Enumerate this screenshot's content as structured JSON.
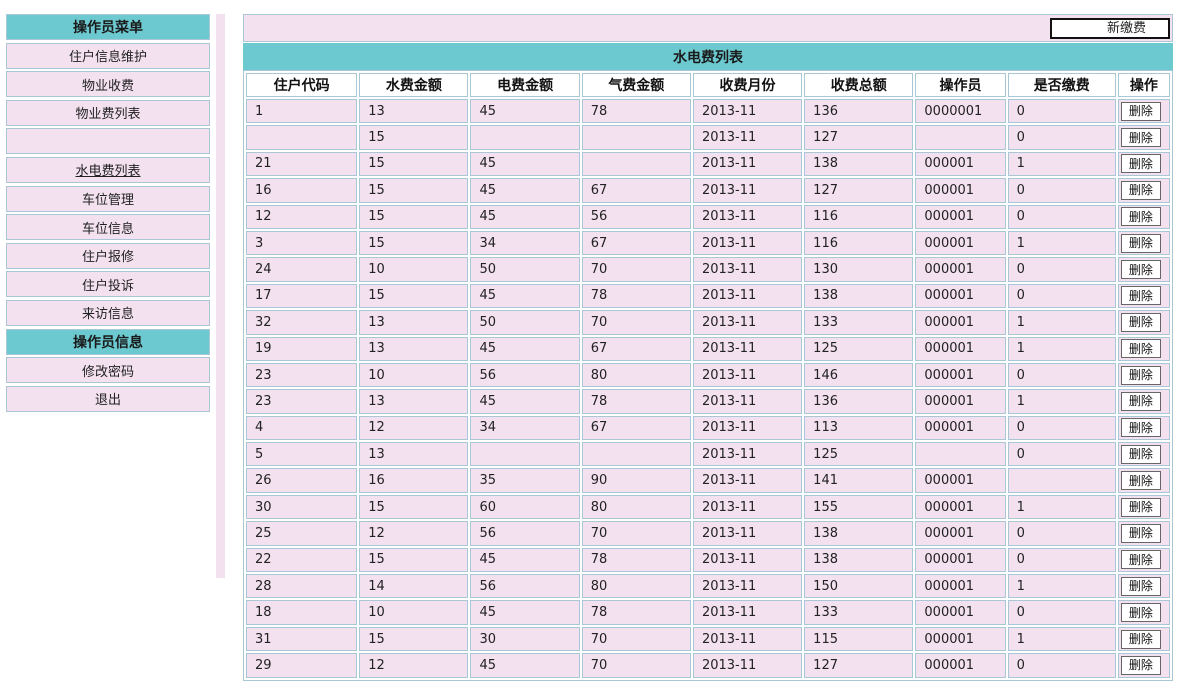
{
  "sidebar": {
    "sections": [
      {
        "header": "操作员菜单",
        "items": [
          "住户信息维护",
          "物业收费",
          "物业费列表",
          "",
          "水电费列表",
          "车位管理",
          "车位信息",
          "住户报修",
          "住户投诉",
          "来访信息"
        ]
      },
      {
        "header": "操作员信息",
        "items": [
          "修改密码",
          "退出"
        ]
      }
    ],
    "active_item": "水电费列表"
  },
  "toolbar": {
    "new_payment_label": "新缴费"
  },
  "list": {
    "title": "水电费列表",
    "columns": [
      "住户代码",
      "水费金额",
      "电费金额",
      "气费金额",
      "收费月份",
      "收费总额",
      "操作员",
      "是否缴费",
      "操作"
    ],
    "delete_label": "删除",
    "rows": [
      [
        "1",
        "13",
        "45",
        "78",
        "2013-11",
        "136",
        "0000001",
        "0"
      ],
      [
        "",
        "15",
        "",
        "",
        "2013-11",
        "127",
        "",
        "0"
      ],
      [
        "21",
        "15",
        "45",
        "",
        "2013-11",
        "138",
        "000001",
        "1"
      ],
      [
        "16",
        "15",
        "45",
        "67",
        "2013-11",
        "127",
        "000001",
        "0"
      ],
      [
        "12",
        "15",
        "45",
        "56",
        "2013-11",
        "116",
        "000001",
        "0"
      ],
      [
        "3",
        "15",
        "34",
        "67",
        "2013-11",
        "116",
        "000001",
        "1"
      ],
      [
        "24",
        "10",
        "50",
        "70",
        "2013-11",
        "130",
        "000001",
        "0"
      ],
      [
        "17",
        "15",
        "45",
        "78",
        "2013-11",
        "138",
        "000001",
        "0"
      ],
      [
        "32",
        "13",
        "50",
        "70",
        "2013-11",
        "133",
        "000001",
        "1"
      ],
      [
        "19",
        "13",
        "45",
        "67",
        "2013-11",
        "125",
        "000001",
        "1"
      ],
      [
        "23",
        "10",
        "56",
        "80",
        "2013-11",
        "146",
        "000001",
        "0"
      ],
      [
        "23",
        "13",
        "45",
        "78",
        "2013-11",
        "136",
        "000001",
        "1"
      ],
      [
        "4",
        "12",
        "34",
        "67",
        "2013-11",
        "113",
        "000001",
        "0"
      ],
      [
        "5",
        "13",
        "",
        "",
        "2013-11",
        "125",
        "",
        "0"
      ],
      [
        "26",
        "16",
        "35",
        "90",
        "2013-11",
        "141",
        "000001",
        ""
      ],
      [
        "30",
        "15",
        "60",
        "80",
        "2013-11",
        "155",
        "000001",
        "1"
      ],
      [
        "25",
        "12",
        "56",
        "70",
        "2013-11",
        "138",
        "000001",
        "0"
      ],
      [
        "22",
        "15",
        "45",
        "78",
        "2013-11",
        "138",
        "000001",
        "0"
      ],
      [
        "28",
        "14",
        "56",
        "80",
        "2013-11",
        "150",
        "000001",
        "1"
      ],
      [
        "18",
        "10",
        "45",
        "78",
        "2013-11",
        "133",
        "000001",
        "0"
      ],
      [
        "31",
        "15",
        "30",
        "70",
        "2013-11",
        "115",
        "000001",
        "1"
      ],
      [
        "29",
        "12",
        "45",
        "70",
        "2013-11",
        "127",
        "000001",
        "0"
      ]
    ]
  },
  "colors": {
    "header_teal": "#6cc9d0",
    "row_pink": "#f3e1f0",
    "border_blue": "#a9c7d4"
  }
}
